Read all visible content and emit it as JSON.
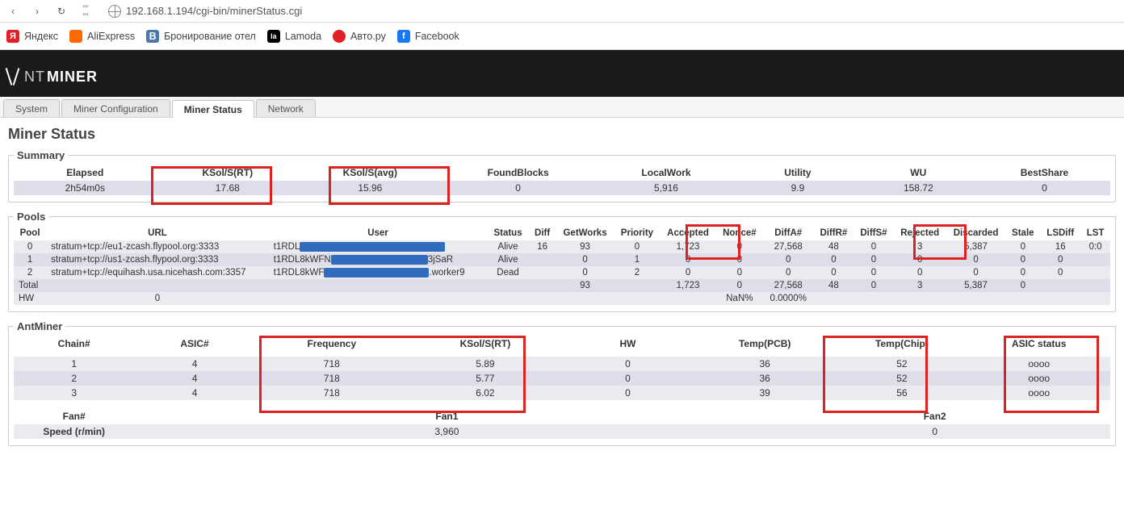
{
  "browser": {
    "url": "192.168.1.194/cgi-bin/minerStatus.cgi",
    "bookmarks": [
      "Яндекс",
      "AliExpress",
      "Бронирование отел",
      "Lamoda",
      "Авто.ру",
      "Facebook"
    ]
  },
  "logo": {
    "thin": "NT",
    "bold": "MINER"
  },
  "tabs": [
    "System",
    "Miner Configuration",
    "Miner Status",
    "Network"
  ],
  "active_tab": 2,
  "page_title": "Miner Status",
  "summary": {
    "title": "Summary",
    "headers": [
      "Elapsed",
      "KSol/S(RT)",
      "KSol/S(avg)",
      "FoundBlocks",
      "LocalWork",
      "Utility",
      "WU",
      "BestShare"
    ],
    "row": [
      "2h54m0s",
      "17.68",
      "15.96",
      "0",
      "5,916",
      "9.9",
      "158.72",
      "0"
    ]
  },
  "pools": {
    "title": "Pools",
    "headers": [
      "Pool",
      "URL",
      "User",
      "Status",
      "Diff",
      "GetWorks",
      "Priority",
      "Accepted",
      "Nonce#",
      "DiffA#",
      "DiffR#",
      "DiffS#",
      "Rejected",
      "Discarded",
      "Stale",
      "LSDiff",
      "LST"
    ],
    "rows": [
      [
        "0",
        "stratum+tcp://eu1-zcash.flypool.org:3333",
        "t1RDL",
        "Alive",
        "16",
        "93",
        "0",
        "1,723",
        "0",
        "27,568",
        "48",
        "0",
        "3",
        "5,387",
        "0",
        "16",
        "0:0"
      ],
      [
        "1",
        "stratum+tcp://us1-zcash.flypool.org:3333",
        "t1RDL8kWFN",
        "Alive",
        "",
        "0",
        "1",
        "0",
        "0",
        "0",
        "0",
        "0",
        "0",
        "0",
        "0",
        "0",
        ""
      ],
      [
        "2",
        "stratum+tcp://equihash.usa.nicehash.com:3357",
        "t1RDL8kWF",
        "Dead",
        "",
        "0",
        "2",
        "0",
        "0",
        "0",
        "0",
        "0",
        "0",
        "0",
        "0",
        "0",
        ""
      ]
    ],
    "user_suffix": [
      "",
      "3jSaR",
      ".worker9"
    ],
    "total_label": "Total",
    "total": [
      "",
      "",
      "",
      "",
      "93",
      "",
      "1,723",
      "0",
      "27,568",
      "48",
      "0",
      "3",
      "5,387",
      "0",
      "",
      ""
    ],
    "hw_label": "HW",
    "hw_row": [
      "0",
      "",
      "",
      "",
      "",
      "",
      "",
      "NaN%",
      "0.0000%",
      "",
      "",
      "",
      "",
      "",
      "",
      ""
    ]
  },
  "antminer": {
    "title": "AntMiner",
    "headers": [
      "Chain#",
      "ASIC#",
      "Frequency",
      "KSol/S(RT)",
      "HW",
      "Temp(PCB)",
      "Temp(Chip)",
      "ASIC status"
    ],
    "rows": [
      [
        "1",
        "4",
        "718",
        "5.89",
        "0",
        "36",
        "52",
        "oooo"
      ],
      [
        "2",
        "4",
        "718",
        "5.77",
        "0",
        "36",
        "52",
        "oooo"
      ],
      [
        "3",
        "4",
        "718",
        "6.02",
        "0",
        "39",
        "56",
        "oooo"
      ]
    ],
    "fan_headers": [
      "Fan#",
      "Fan1",
      "Fan2"
    ],
    "fan_speed_label": "Speed (r/min)",
    "fan_speeds": [
      "3,960",
      "0"
    ]
  }
}
